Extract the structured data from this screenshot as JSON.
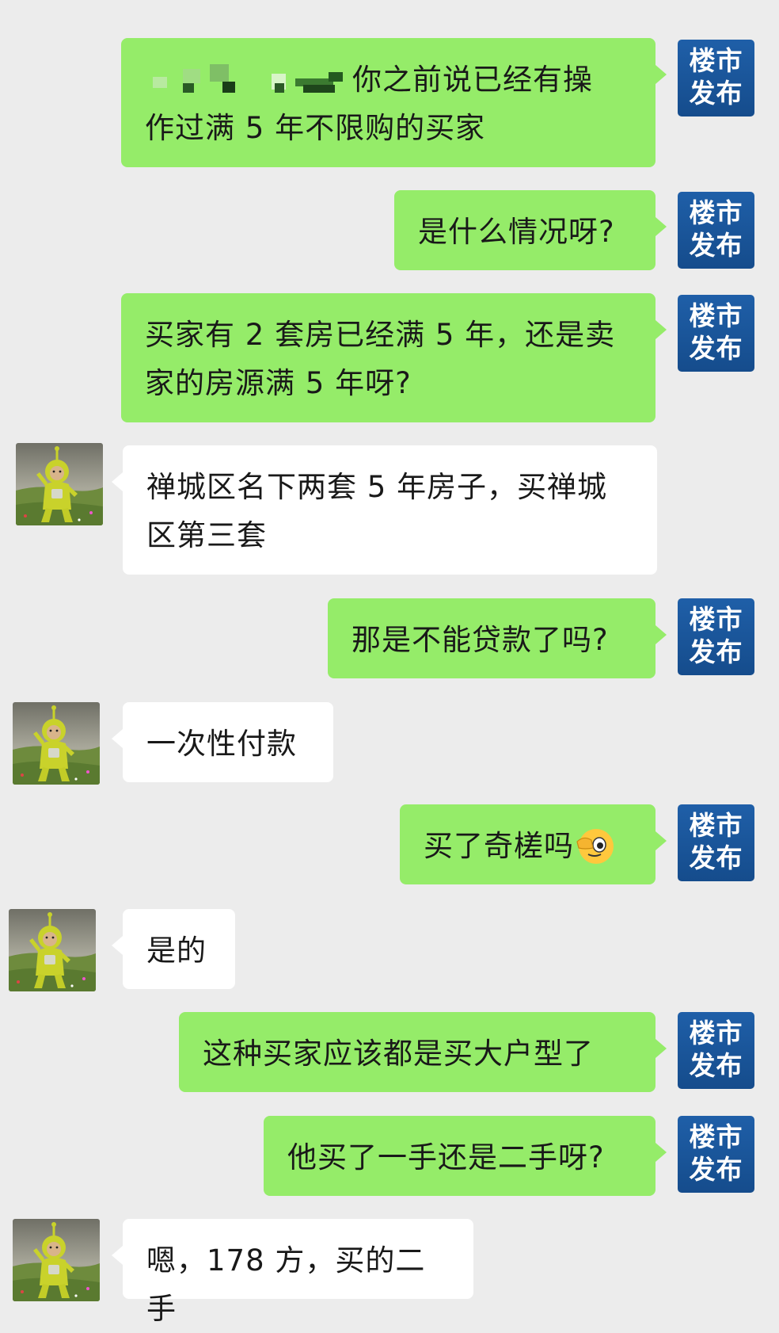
{
  "chat": {
    "my_avatar": {
      "line1": "楼市",
      "line2": "发布"
    },
    "messages": [
      {
        "sender": "me",
        "line1": "你之前说已经有操",
        "line2": "作过满 5 年不限购的买家"
      },
      {
        "sender": "me",
        "text": "是什么情况呀?"
      },
      {
        "sender": "me",
        "line1": "买家有 2 套房已经满 5 年，还是卖",
        "line2": "家的房源满 5 年呀?"
      },
      {
        "sender": "other",
        "line1": "禅城区名下两套 5 年房子，买禅城",
        "line2": "区第三套"
      },
      {
        "sender": "me",
        "text": "那是不能贷款了吗?"
      },
      {
        "sender": "other",
        "text": "一次性付款"
      },
      {
        "sender": "me",
        "text": "买了奇槎吗",
        "emoji": "wink-emoji"
      },
      {
        "sender": "other",
        "text": "是的"
      },
      {
        "sender": "me",
        "text": "这种买家应该都是买大户型了"
      },
      {
        "sender": "me",
        "text": "他买了一手还是二手呀?"
      },
      {
        "sender": "other",
        "text": "嗯，178 方，买的二手"
      }
    ]
  },
  "colors": {
    "background": "#ececec",
    "outgoing_bubble": "#95ec69",
    "incoming_bubble": "#ffffff",
    "my_avatar_bg": "#1a5699",
    "text": "#191919"
  },
  "icons": {
    "my_avatar": "blue-square-logo",
    "other_avatar": "teletubby-photo",
    "redaction": "pixelated-name"
  }
}
